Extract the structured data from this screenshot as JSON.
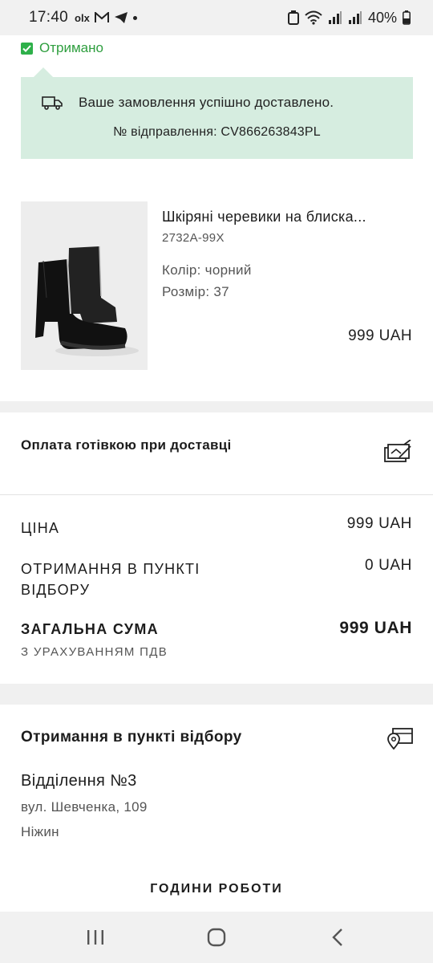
{
  "status_bar": {
    "time": "17:40",
    "notifications": [
      "olx-icon",
      "gmail-icon",
      "telegram-icon"
    ],
    "battery": "40%"
  },
  "order_status": {
    "label": "Отримано",
    "color": "#2eb04a"
  },
  "banner": {
    "message": "Ваше замовлення успішно доставлено.",
    "tracking": "№ відправлення: CV866263843PL",
    "background": "#d6ede0"
  },
  "product": {
    "name": "Шкіряні черевики на блиска...",
    "sku": "2732A-99X",
    "color": "Колір: чорний",
    "size": "Розмір: 37",
    "price": "999 UAH"
  },
  "payment": {
    "method": "Оплата готівкою при доставці"
  },
  "totals": {
    "price_label": "ЦІНА",
    "price_value": "999 UAH",
    "pickup_label_line1": "ОТРИМАННЯ В ПУНКТІ",
    "pickup_label_line2": "ВІДБОРУ",
    "pickup_value": "0 UAH",
    "total_label": "ЗАГАЛЬНА СУМА",
    "total_value": "999 UAH",
    "vat_note": "З УРАХУВАННЯМ ПДВ"
  },
  "pickup": {
    "title": "Отримання в пункті відбору",
    "branch": "Відділення №3",
    "street": "вул. Шевченка, 109",
    "city": "Ніжин",
    "hours_label": "ГОДИНИ РОБОТИ"
  }
}
